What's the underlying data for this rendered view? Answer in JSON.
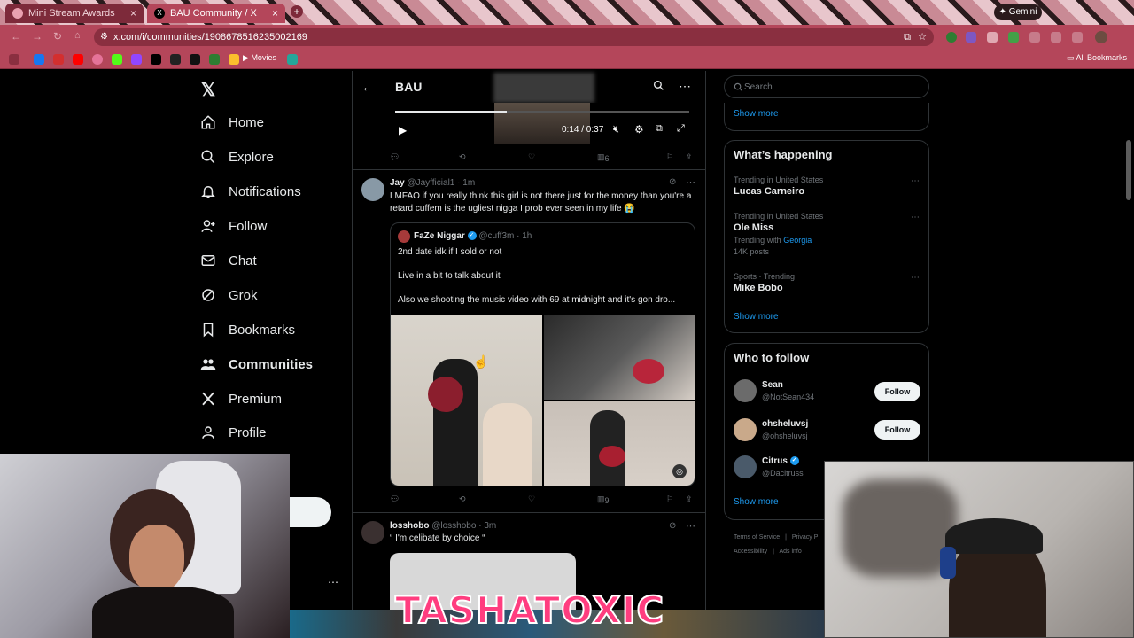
{
  "browser": {
    "tabs": [
      {
        "title": "Mini Stream Awards",
        "active": false
      },
      {
        "title": "BAU Community / X",
        "active": true
      }
    ],
    "gemini_label": "Gemini",
    "url": "x.com/i/communities/1908678516235002169",
    "bookmarks_label": "Movies",
    "all_bookmarks": "All Bookmarks"
  },
  "nav": {
    "items": [
      {
        "label": "Home",
        "icon": "home-icon"
      },
      {
        "label": "Explore",
        "icon": "search-icon"
      },
      {
        "label": "Notifications",
        "icon": "bell-icon"
      },
      {
        "label": "Follow",
        "icon": "person-add-icon"
      },
      {
        "label": "Chat",
        "icon": "mail-icon"
      },
      {
        "label": "Grok",
        "icon": "grok-icon"
      },
      {
        "label": "Bookmarks",
        "icon": "bookmark-icon"
      },
      {
        "label": "Communities",
        "icon": "people-icon"
      },
      {
        "label": "Premium",
        "icon": "x-icon"
      },
      {
        "label": "Profile",
        "icon": "person-icon"
      }
    ],
    "active": "Communities"
  },
  "header": {
    "title": "BAU"
  },
  "video": {
    "time": "0:14 / 0:37",
    "progress": 0.38,
    "views": "6"
  },
  "post1": {
    "name": "Jay",
    "handle": "@Jayfficial1",
    "time": "1m",
    "text": "LMFAO if you really think this girl is not there just for the money than you're a retard cuffem is the ugliest nigga I prob ever seen in my life 😭",
    "views": "9",
    "quote": {
      "name": "FaZe Niggar",
      "handle": "@cuff3m",
      "time": "1h",
      "line1": "2nd date idk if I sold or not",
      "line2": "Live in a bit to talk about it",
      "line3": "Also we shooting the music video with 69 at midnight and it's gon dro..."
    }
  },
  "post2": {
    "name": "losshobo",
    "handle": "@losshobo",
    "time": "3m",
    "text": "“ I'm celibate by choice “"
  },
  "sidebar": {
    "search_placeholder": "Search",
    "show_more": "Show more",
    "whats_happening": "What’s happening",
    "trends": [
      {
        "meta": "Trending in United States",
        "name": "Lucas Carneiro",
        "extra": "",
        "extra_link": "",
        "posts": ""
      },
      {
        "meta": "Trending in United States",
        "name": "Ole Miss",
        "extra": "Trending with",
        "extra_link": "Georgia",
        "posts": "14K posts"
      },
      {
        "meta": "Sports · Trending",
        "name": "Mike Bobo",
        "extra": "",
        "extra_link": "",
        "posts": ""
      }
    ],
    "who_to_follow": "Who to follow",
    "follow_label": "Follow",
    "suggestions": [
      {
        "name": "Sean",
        "handle": "@NotSean434"
      },
      {
        "name": "ohsheluvsj",
        "handle": "@ohsheluvsj"
      },
      {
        "name": "Citrus",
        "handle": "@Dacitruss"
      }
    ],
    "footer": [
      "Terms of Service",
      "Privacy P",
      "Accessibility",
      "Ads info"
    ]
  },
  "overlay": {
    "streamer_name": "TASHATOXIC"
  },
  "colors": {
    "accent": "#1d9bf0",
    "chrome": "#b4465a",
    "overlay_text": "#ff3d7f"
  }
}
